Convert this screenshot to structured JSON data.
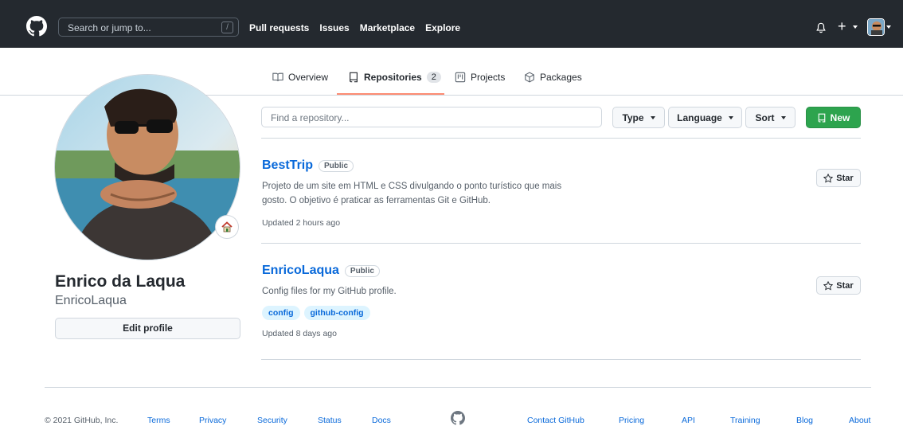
{
  "header": {
    "search_placeholder": "Search or jump to...",
    "slash_key": "/",
    "nav": [
      "Pull requests",
      "Issues",
      "Marketplace",
      "Explore"
    ]
  },
  "tabs": [
    {
      "label": "Overview"
    },
    {
      "label": "Repositories",
      "count": "2"
    },
    {
      "label": "Projects"
    },
    {
      "label": "Packages"
    }
  ],
  "profile": {
    "name": "Enrico da Laqua",
    "login": "EnricoLaqua",
    "edit_label": "Edit profile"
  },
  "filters": {
    "find_placeholder": "Find a repository...",
    "type_label": "Type",
    "language_label": "Language",
    "sort_label": "Sort",
    "new_label": "New"
  },
  "repos": [
    {
      "name": "BestTrip",
      "visibility": "Public",
      "description": "Projeto de um site em HTML e CSS divulgando o ponto turístico que mais gosto. O objetivo é praticar as ferramentas Git e GitHub.",
      "topics": [],
      "updated": "Updated 2 hours ago",
      "star_label": "Star"
    },
    {
      "name": "EnricoLaqua",
      "visibility": "Public",
      "description": "Config files for my GitHub profile.",
      "topics": [
        "config",
        "github-config"
      ],
      "updated": "Updated 8 days ago",
      "star_label": "Star"
    }
  ],
  "footer": {
    "copyright": "© 2021 GitHub, Inc.",
    "links_left": [
      "Terms",
      "Privacy",
      "Security",
      "Status",
      "Docs"
    ],
    "links_right": [
      "Contact GitHub",
      "Pricing",
      "API",
      "Training",
      "Blog",
      "About"
    ]
  },
  "colors": {
    "header_bg": "#24292f",
    "link": "#0969da",
    "new_button": "#2da44e",
    "active_tab_underline": "#fd8c73"
  },
  "icons": [
    "github-logo-icon",
    "bell-icon",
    "plus-icon",
    "book-icon",
    "repo-icon",
    "project-icon",
    "package-icon",
    "star-icon",
    "home-emoji-icon"
  ]
}
